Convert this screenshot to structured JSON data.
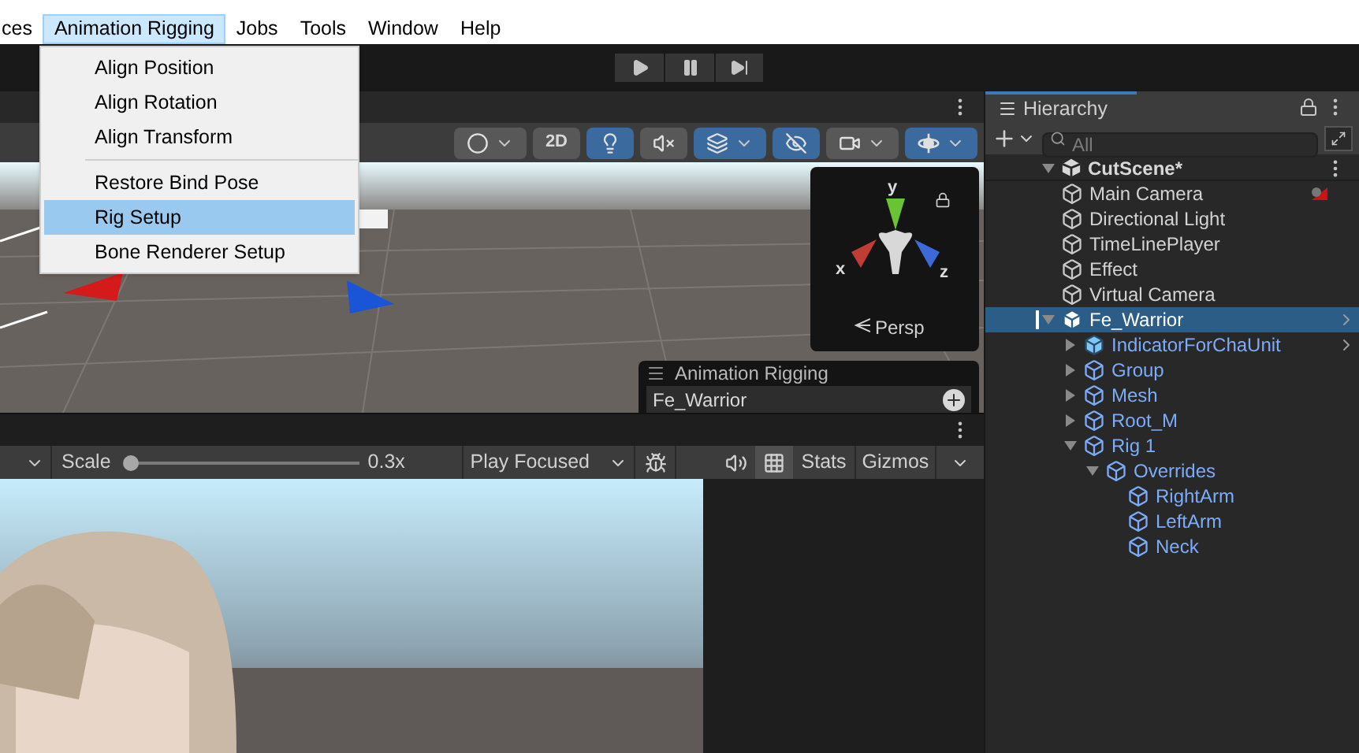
{
  "menubar": {
    "items": [
      {
        "label": "ces",
        "selected": false
      },
      {
        "label": "Animation Rigging",
        "selected": true
      },
      {
        "label": "Jobs",
        "selected": false
      },
      {
        "label": "Tools",
        "selected": false
      },
      {
        "label": "Window",
        "selected": false
      },
      {
        "label": "Help",
        "selected": false
      }
    ]
  },
  "dropdown": {
    "items": [
      {
        "kind": "item",
        "label": "Align Position",
        "selected": false
      },
      {
        "kind": "item",
        "label": "Align Rotation",
        "selected": false
      },
      {
        "kind": "item",
        "label": "Align Transform",
        "selected": false
      },
      {
        "kind": "separator"
      },
      {
        "kind": "item",
        "label": "Restore Bind Pose",
        "selected": false
      },
      {
        "kind": "item",
        "label": "Rig Setup",
        "selected": true
      },
      {
        "kind": "item",
        "label": "Bone Renderer Setup",
        "selected": false
      }
    ]
  },
  "scene_view": {
    "toolbar": [
      {
        "kind": "shading",
        "active": false
      },
      {
        "kind": "mode",
        "label": "2D",
        "active": false
      },
      {
        "kind": "lighting",
        "active": true
      },
      {
        "kind": "audio",
        "active": false
      },
      {
        "kind": "effects",
        "active": true
      },
      {
        "kind": "visibility",
        "active": true
      },
      {
        "kind": "camera",
        "active": false
      },
      {
        "kind": "gizmos",
        "active": true
      }
    ],
    "orientation": {
      "axes": [
        {
          "label": "y"
        },
        {
          "label": "x"
        },
        {
          "label": "z"
        }
      ],
      "projection": "Persp"
    },
    "overlay": {
      "title": "Animation Rigging",
      "item": "Fe_Warrior"
    }
  },
  "game_view": {
    "scale_label": "Scale",
    "scale": {
      "level": 0.0
    },
    "scale_reading": "0.3x",
    "play_mode": "Play Focused",
    "mute_audio": false,
    "stats_grid": true,
    "stats": "Stats",
    "gizmos": "Gizmos"
  },
  "hierarchy": {
    "title": "Hierarchy",
    "search_placeholder": "All",
    "scene": {
      "label": "CutScene*",
      "expanded": true,
      "children": [
        {
          "label": "Main Camera",
          "kind": "object",
          "selected": false,
          "badge": true
        },
        {
          "label": "Directional Light",
          "kind": "object",
          "selected": false,
          "badge": false
        },
        {
          "label": "TimeLinePlayer",
          "kind": "object",
          "selected": false,
          "badge": false
        },
        {
          "label": "Effect",
          "kind": "object",
          "selected": false,
          "badge": false
        },
        {
          "label": "Virtual Camera",
          "kind": "object",
          "selected": false,
          "badge": false
        },
        {
          "label": "Fe_Warrior",
          "kind": "prefab",
          "selected": true,
          "badge": false,
          "expanded": true,
          "children": [
            {
              "label": "IndicatorForChaUnit",
              "kind": "prefab",
              "selected": false,
              "badge": false,
              "expanded": false
            },
            {
              "label": "Group",
              "kind": "prefab_part",
              "selected": false,
              "badge": false,
              "expanded": false
            },
            {
              "label": "Mesh",
              "kind": "prefab_part",
              "selected": false,
              "badge": false,
              "expanded": false
            },
            {
              "label": "Root_M",
              "kind": "prefab_part",
              "selected": false,
              "badge": false,
              "expanded": false
            },
            {
              "label": "Rig 1",
              "kind": "prefab_part",
              "selected": false,
              "badge": false,
              "expanded": true,
              "children": [
                {
                  "label": "Overrides",
                  "kind": "prefab_part",
                  "selected": false,
                  "badge": false,
                  "expanded": true,
                  "children": [
                    {
                      "label": "RightArm",
                      "kind": "prefab_part",
                      "selected": false,
                      "badge": false
                    },
                    {
                      "label": "LeftArm",
                      "kind": "prefab_part",
                      "selected": false,
                      "badge": false
                    },
                    {
                      "label": "Neck",
                      "kind": "prefab_part",
                      "selected": false,
                      "badge": false
                    }
                  ]
                }
              ]
            }
          ]
        }
      ]
    }
  }
}
